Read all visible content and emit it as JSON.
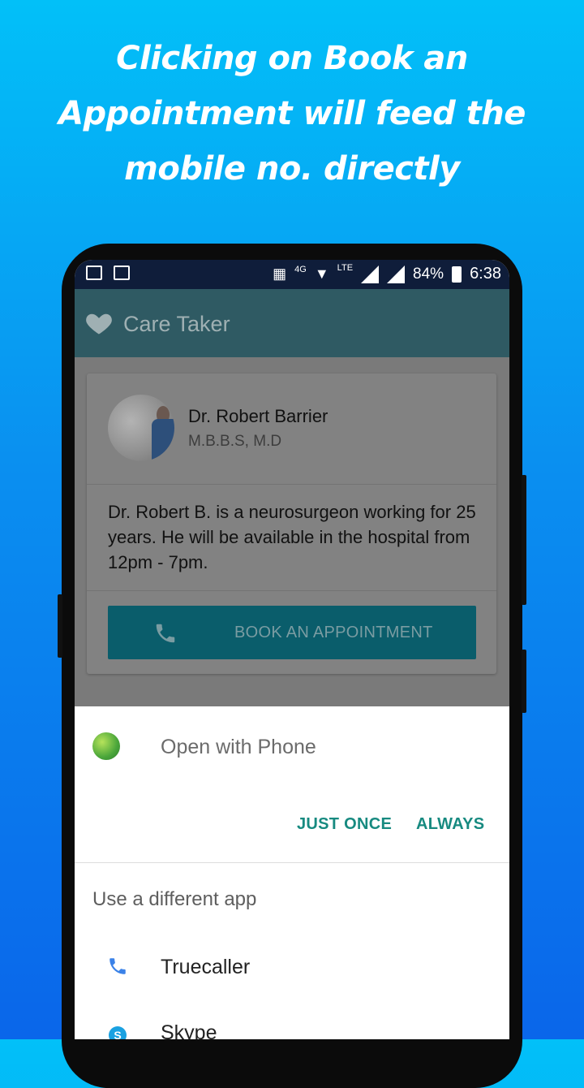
{
  "promo": {
    "line1": "Clicking on Book an",
    "line2": "Appointment will feed the",
    "line3": "mobile no. directly"
  },
  "status_bar": {
    "network_label": "LTE",
    "network_sub": "4G",
    "battery": "84%",
    "time": "6:38"
  },
  "app_bar": {
    "title": "Care Taker",
    "icon": "heart-icon"
  },
  "doctor_card": {
    "name": "Dr. Robert Barrier",
    "degree": "M.B.B.S, M.D",
    "description": "Dr. Robert B. is a neurosurgeon working for 25 years. He will be available in the hospital from 12pm - 7pm.",
    "book_button_label": "BOOK AN APPOINTMENT",
    "book_button_icon": "phone-icon"
  },
  "chooser": {
    "open_with": "Open with Phone",
    "just_once": "JUST ONCE",
    "always": "ALWAYS",
    "different_app": "Use a different app",
    "apps": [
      {
        "name": "Truecaller",
        "icon": "phone-icon"
      },
      {
        "name": "Skype",
        "icon": "skype-icon"
      }
    ]
  },
  "colors": {
    "accent": "#178a80",
    "app_bar": "#2f5a63",
    "button": "#0a5d6b",
    "status_bar": "#0f1d3a"
  }
}
